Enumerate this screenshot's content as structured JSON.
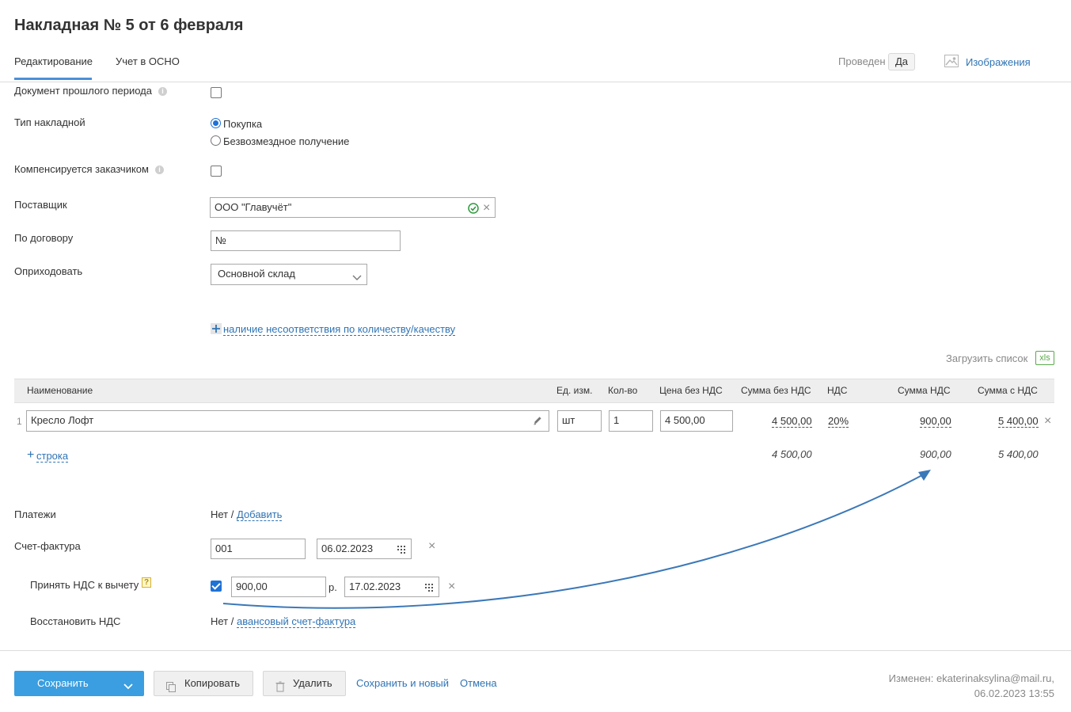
{
  "header": {
    "title": "Накладная № 5 от 6 февраля",
    "tabs": [
      {
        "label": "Редактирование",
        "active": true
      },
      {
        "label": "Учет в ОСНО",
        "active": false
      }
    ],
    "posted_label": "Проведен",
    "posted_value": "Да",
    "images_label": "Изображения"
  },
  "form": {
    "prev_period": {
      "label": "Документ прошлого периода",
      "checked": false
    },
    "invoice_type": {
      "label": "Тип накладной",
      "options": [
        {
          "label": "Покупка",
          "selected": true
        },
        {
          "label": "Безвозмездное получение",
          "selected": false
        }
      ]
    },
    "compensated": {
      "label": "Компенсируется заказчиком",
      "checked": false
    },
    "supplier": {
      "label": "Поставщик",
      "value": "ООО \"Главучёт\""
    },
    "contract": {
      "label": "По договору",
      "placeholder": "№"
    },
    "warehouse": {
      "label": "Оприходовать",
      "value": "Основной склад"
    },
    "mismatch_link": "наличие несоответствия по количеству/качеству"
  },
  "table": {
    "upload_label": "Загрузить список",
    "xls_label": "xls",
    "columns": [
      "Наименование",
      "Ед. изм.",
      "Кол-во",
      "Цена без НДС",
      "Сумма без НДС",
      "НДС",
      "Сумма НДС",
      "Сумма с НДС"
    ],
    "rows": [
      {
        "index": "1",
        "name": "Кресло Лофт",
        "unit": "шт",
        "qty": "1",
        "price": "4 500,00",
        "sum_without_vat": "4 500,00",
        "vat_rate": "20%",
        "vat_sum": "900,00",
        "sum_with_vat": "5 400,00"
      }
    ],
    "add_row_label": "строка",
    "totals": {
      "sum_without_vat": "4 500,00",
      "vat_sum": "900,00",
      "sum_with_vat": "5 400,00"
    }
  },
  "payments": {
    "label": "Платежи",
    "value": "Нет /",
    "add_link": "Добавить"
  },
  "invoice": {
    "label": "Счет-фактура",
    "number": "001",
    "date": "06.02.2023"
  },
  "vat_deduction": {
    "label": "Принять НДС к вычету",
    "help": "?",
    "checked": true,
    "amount": "900,00",
    "currency": "р.",
    "date": "17.02.2023"
  },
  "restore_vat": {
    "label": "Восстановить НДС",
    "value": "Нет /",
    "link": "авансовый счет-фактура"
  },
  "footer": {
    "save_label": "Сохранить",
    "copy_label": "Копировать",
    "delete_label": "Удалить",
    "save_new_label": "Сохранить и новый",
    "cancel_label": "Отмена",
    "changed_line1": "Изменен: ekaterinaksylina@mail.ru,",
    "changed_line2": "06.02.2023 13:55"
  },
  "colors": {
    "accent": "#3a9ee0",
    "link": "#2f74b5",
    "arrow": "#3b78b8",
    "ok_green": "#2e9a3d"
  },
  "icons": [
    "info-icon",
    "check-circle-icon",
    "close-icon",
    "chevron-down-icon",
    "plus-icon",
    "pencil-icon",
    "calendar-icon",
    "help-icon",
    "image-icon",
    "copy-icon",
    "trash-icon",
    "xls-icon"
  ]
}
